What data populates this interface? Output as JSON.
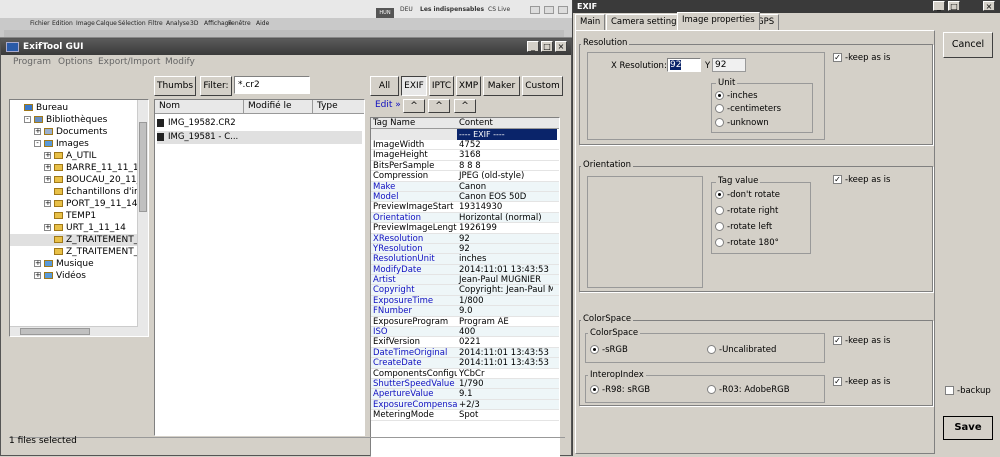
{
  "photoshop": {
    "menus": [
      "Fichier",
      "Edition",
      "Image",
      "Calque",
      "Sélection",
      "Filtre",
      "Analyse",
      "3D",
      "Affichage",
      "Fenêtre",
      "Aide"
    ],
    "toolbar_items": [
      "HUN",
      "DEU",
      "Les indispensables",
      "CS Live"
    ]
  },
  "exiftool": {
    "title": "ExifTool GUI",
    "menus": [
      "Program",
      "Options",
      "Export/Import",
      "Modify"
    ],
    "thumbs_label": "Thumbs",
    "filter_label": "Filter:",
    "filter_value": "*.cr2",
    "tabs": [
      "All",
      "EXIF",
      "IPTC",
      "XMP",
      "Maker",
      "Custom"
    ],
    "edit_label": "Edit »",
    "tree": [
      {
        "label": "Bureau",
        "level": 0,
        "exp": "",
        "icon": "desktop"
      },
      {
        "label": "Bibliothèques",
        "level": 1,
        "exp": "-",
        "icon": "lib"
      },
      {
        "label": "Documents",
        "level": 2,
        "exp": "+",
        "icon": "doc"
      },
      {
        "label": "Images",
        "level": 2,
        "exp": "-",
        "icon": "img"
      },
      {
        "label": "A_UTIL",
        "level": 3,
        "exp": "+",
        "icon": "folder"
      },
      {
        "label": "BARRE_11_11_14",
        "level": 3,
        "exp": "+",
        "icon": "folder"
      },
      {
        "label": "BOUCAU_20_11_14",
        "level": 3,
        "exp": "+",
        "icon": "folder"
      },
      {
        "label": "Échantillons d'images",
        "level": 3,
        "exp": "",
        "icon": "folder"
      },
      {
        "label": "PORT_19_11_14",
        "level": 3,
        "exp": "+",
        "icon": "folder"
      },
      {
        "label": "TEMP1",
        "level": 3,
        "exp": "",
        "icon": "folder"
      },
      {
        "label": "URT_1_11_14",
        "level": 3,
        "exp": "+",
        "icon": "folder"
      },
      {
        "label": "Z_TRAITEMENT_BA",
        "level": 3,
        "exp": "",
        "icon": "folder"
      },
      {
        "label": "Z_TRAITEMENT_T",
        "level": 3,
        "exp": "",
        "icon": "folder"
      },
      {
        "label": "Musique",
        "level": 2,
        "exp": "+",
        "icon": "music"
      },
      {
        "label": "Vidéos",
        "level": 2,
        "exp": "+",
        "icon": "video"
      }
    ],
    "file_columns": [
      "Nom",
      "Modifié le",
      "Type"
    ],
    "files": [
      "IMG_19582.CR2",
      "IMG_19581 - C..."
    ],
    "table_headers": [
      "Tag Name",
      "Content"
    ],
    "exif_section": "---- EXIF ----",
    "rows": [
      {
        "tag": "ImageWidth",
        "val": "4752",
        "blue": false
      },
      {
        "tag": "ImageHeight",
        "val": "3168",
        "blue": false
      },
      {
        "tag": "BitsPerSample",
        "val": "8 8 8",
        "blue": false
      },
      {
        "tag": "Compression",
        "val": "JPEG (old-style)",
        "blue": false
      },
      {
        "tag": "Make",
        "val": "Canon",
        "blue": true
      },
      {
        "tag": "Model",
        "val": "Canon EOS 50D",
        "blue": true
      },
      {
        "tag": "PreviewImageStart",
        "val": "19314930",
        "blue": false
      },
      {
        "tag": "Orientation",
        "val": "Horizontal (normal)",
        "blue": true
      },
      {
        "tag": "PreviewImageLength",
        "val": "1926199",
        "blue": false
      },
      {
        "tag": "XResolution",
        "val": "92",
        "blue": true
      },
      {
        "tag": "YResolution",
        "val": "92",
        "blue": true
      },
      {
        "tag": "ResolutionUnit",
        "val": "inches",
        "blue": true
      },
      {
        "tag": "ModifyDate",
        "val": "2014:11:01 13:43:53",
        "blue": true
      },
      {
        "tag": "Artist",
        "val": "Jean-Paul MUGNIER",
        "blue": true
      },
      {
        "tag": "Copyright",
        "val": "Copyright: Jean-Paul MUGNIER",
        "blue": true
      },
      {
        "tag": "ExposureTime",
        "val": "1/800",
        "blue": true
      },
      {
        "tag": "FNumber",
        "val": "9.0",
        "blue": true
      },
      {
        "tag": "ExposureProgram",
        "val": "Program AE",
        "blue": false
      },
      {
        "tag": "ISO",
        "val": "400",
        "blue": true
      },
      {
        "tag": "ExifVersion",
        "val": "0221",
        "blue": false
      },
      {
        "tag": "DateTimeOriginal",
        "val": "2014:11:01 13:43:53",
        "blue": true
      },
      {
        "tag": "CreateDate",
        "val": "2014:11:01 13:43:53",
        "blue": true
      },
      {
        "tag": "ComponentsConfiguration",
        "val": "YCbCr",
        "blue": false
      },
      {
        "tag": "ShutterSpeedValue",
        "val": "1/790",
        "blue": true
      },
      {
        "tag": "ApertureValue",
        "val": "9.1",
        "blue": true
      },
      {
        "tag": "ExposureCompensation",
        "val": "+2/3",
        "blue": true
      },
      {
        "tag": "MeteringMode",
        "val": "Spot",
        "blue": false
      }
    ],
    "status": "1 files selected"
  },
  "exif_dialog": {
    "title": "EXIF",
    "tabs": [
      "Main",
      "Camera settings",
      "Image properties",
      "GPS"
    ],
    "cancel": "Cancel",
    "save": "Save",
    "backup": "-backup",
    "keep_as_is": "-keep as is",
    "resolution": {
      "label": "Resolution",
      "x_label": "X Resolution:",
      "x_value": "92",
      "y_label": "Y",
      "y_value": "92",
      "unit_label": "Unit",
      "units": [
        "-inches",
        "-centimeters",
        "-unknown"
      ]
    },
    "orientation": {
      "label": "Orientation",
      "tag_label": "Tag value",
      "options": [
        "-don't rotate",
        "-rotate right",
        "-rotate left",
        "-rotate 180°"
      ]
    },
    "colorspace": {
      "label": "ColorSpace",
      "inner_label": "ColorSpace",
      "options": [
        "-sRGB",
        "-Uncalibrated"
      ],
      "interop_label": "InteropIndex",
      "interop_options": [
        "-R98: sRGB",
        "-R03: AdobeRGB"
      ]
    }
  }
}
